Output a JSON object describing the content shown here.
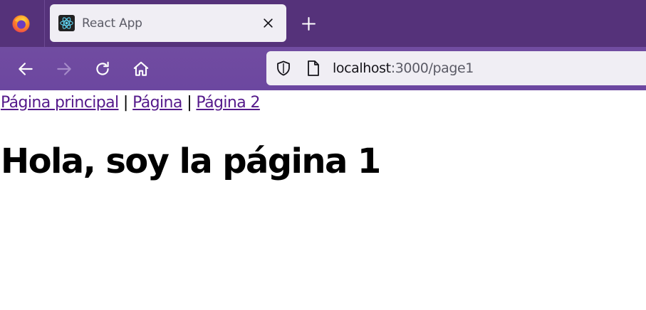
{
  "browser": {
    "tab": {
      "title": "React App"
    },
    "address_bar": {
      "host": "localhost",
      "rest": ":3000/page1"
    }
  },
  "page": {
    "nav_links": [
      {
        "label": "Página principal"
      },
      {
        "label": "Página"
      },
      {
        "label": "Página 2"
      }
    ],
    "separator": "|",
    "heading": "Hola, soy la página 1"
  },
  "colors": {
    "tabbar_bg": "#55327a",
    "navbar_bg": "#714ca1",
    "visited_link": "#551a8b"
  },
  "icons": [
    "firefox-logo-icon",
    "react-icon",
    "close-icon",
    "plus-icon",
    "back-arrow-icon",
    "forward-arrow-icon",
    "reload-icon",
    "home-icon",
    "shield-icon",
    "page-icon"
  ]
}
